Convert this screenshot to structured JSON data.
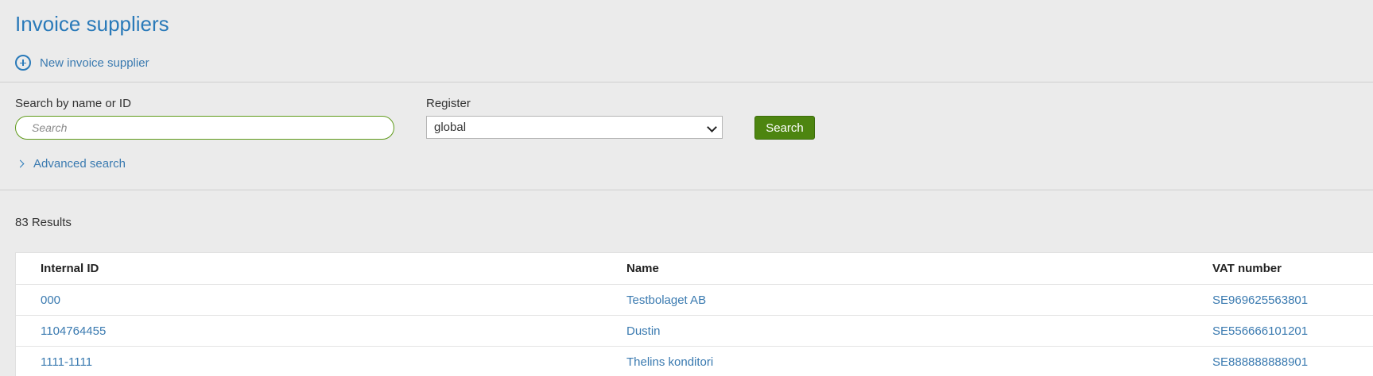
{
  "page": {
    "title": "Invoice suppliers"
  },
  "actions": {
    "new_supplier_label": "New invoice supplier"
  },
  "search": {
    "label": "Search by name or ID",
    "placeholder": "Search",
    "value": ""
  },
  "register": {
    "label": "Register",
    "selected": "global"
  },
  "search_button_label": "Search",
  "advanced_search_label": "Advanced search",
  "results": {
    "count_text": "83 Results",
    "columns": [
      "Internal ID",
      "Name",
      "VAT number"
    ],
    "rows": [
      {
        "internal_id": "000",
        "name": "Testbolaget AB",
        "vat": "SE969625563801"
      },
      {
        "internal_id": "1104764455",
        "name": "Dustin",
        "vat": "SE556666101201"
      },
      {
        "internal_id": "1111-1111",
        "name": "Thelins konditori",
        "vat": "SE888888888901"
      }
    ]
  },
  "colors": {
    "accent": "#2a7ab9",
    "link": "#3a7ab0",
    "primary_button": "#4d8510",
    "background": "#ebebeb"
  },
  "icons": {
    "new_supplier": "plus-circle-icon",
    "register_select": "chevron-down-icon",
    "advanced_search": "chevron-right-icon"
  }
}
